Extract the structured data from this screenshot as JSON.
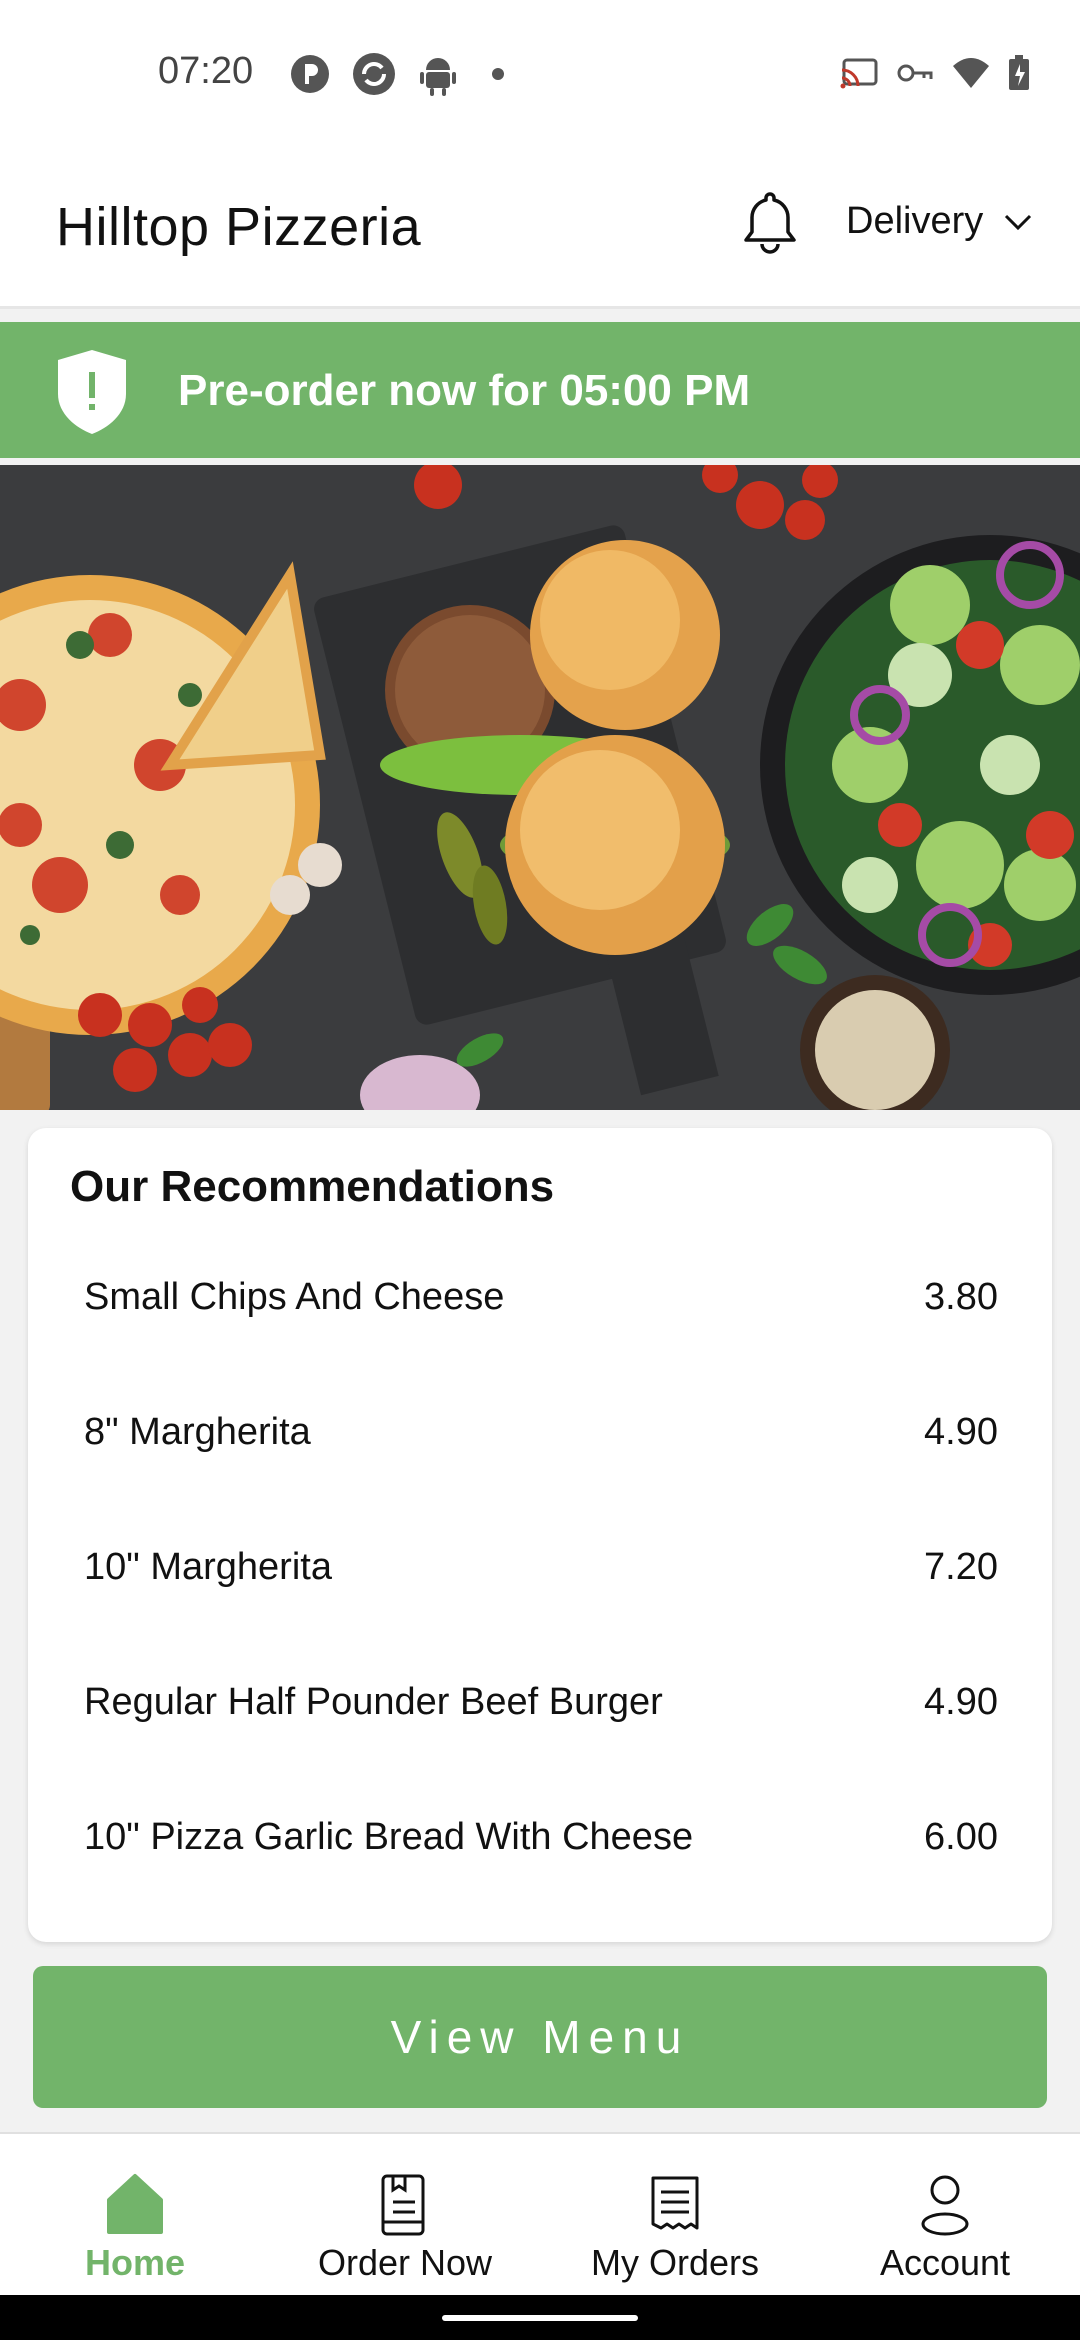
{
  "status_bar": {
    "time": "07:20",
    "left_icons": [
      "p-icon",
      "sync-icon",
      "android-icon",
      "dot-icon"
    ],
    "right_icons": [
      "cast-icon",
      "key-icon",
      "wifi-icon",
      "battery-icon"
    ]
  },
  "header": {
    "title": "Hilltop Pizzeria",
    "notification_icon": "bell-icon",
    "delivery_mode": "Delivery"
  },
  "banner": {
    "icon": "shield-alert-icon",
    "text": "Pre-order now for 05:00 PM",
    "color": "#72b46a"
  },
  "hero": {
    "image_desc_icon": "food-banner-image"
  },
  "recommendations": {
    "title": "Our Recommendations",
    "items": [
      {
        "name": "Small Chips And Cheese",
        "price": "3.80"
      },
      {
        "name": "8\" Margherita",
        "price": "4.90"
      },
      {
        "name": "10\" Margherita",
        "price": "7.20"
      },
      {
        "name": "Regular Half Pounder Beef Burger",
        "price": "4.90"
      },
      {
        "name": "10\" Pizza Garlic Bread With Cheese",
        "price": "6.00"
      }
    ]
  },
  "view_menu": {
    "label": "View Menu"
  },
  "bottom_nav": {
    "items": [
      {
        "label": "Home",
        "icon": "home-icon",
        "active": true
      },
      {
        "label": "Order Now",
        "icon": "order-book-icon",
        "active": false
      },
      {
        "label": "My Orders",
        "icon": "receipt-icon",
        "active": false
      },
      {
        "label": "Account",
        "icon": "person-icon",
        "active": false
      }
    ]
  },
  "colors": {
    "accent": "#72b46a",
    "background": "#f2f2f2"
  }
}
